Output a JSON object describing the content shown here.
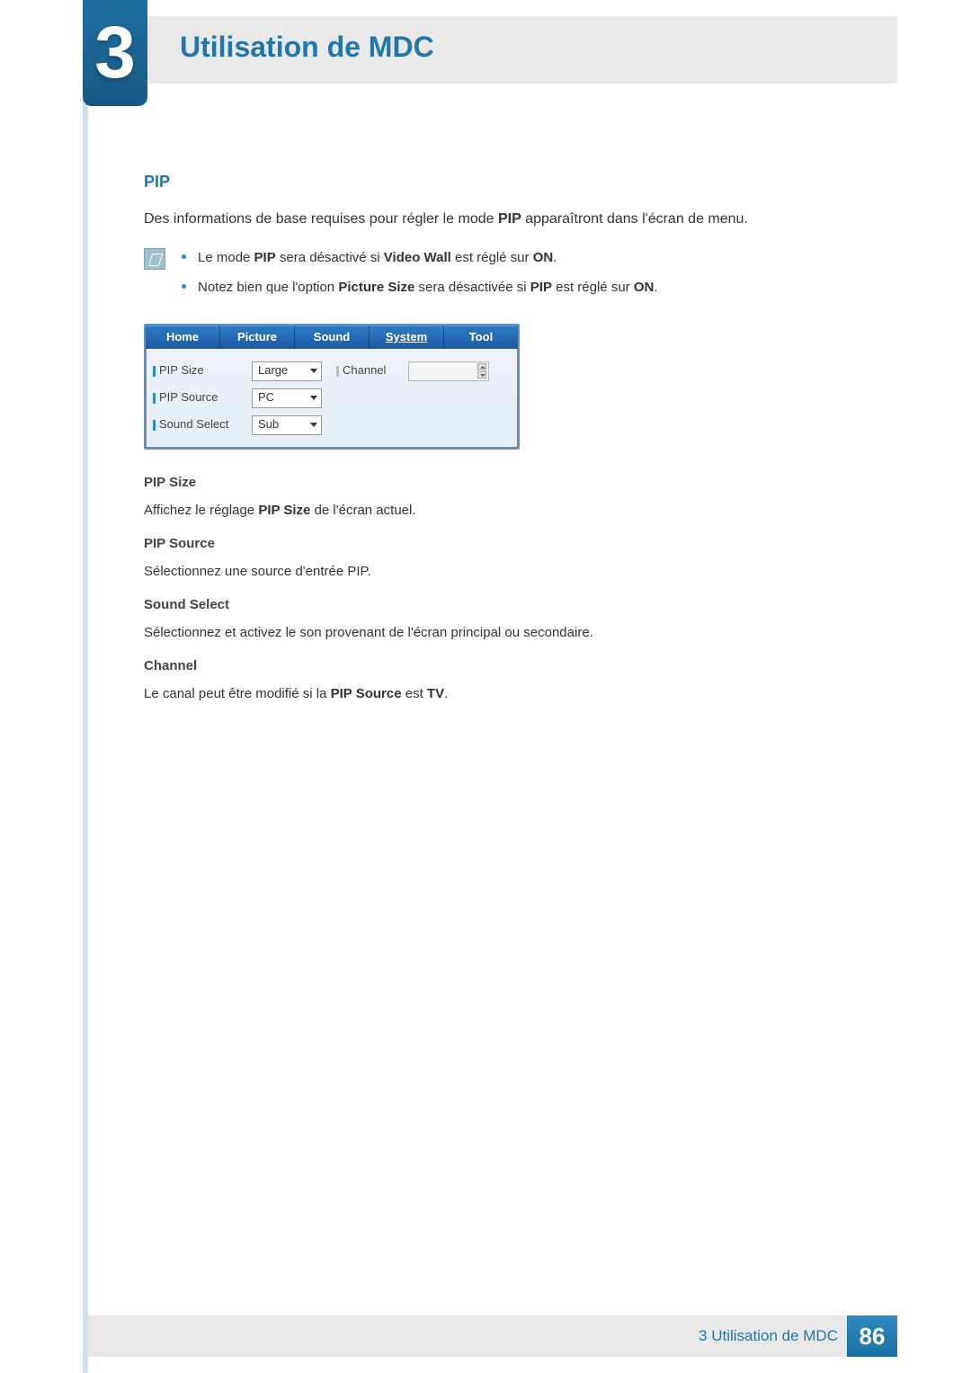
{
  "chapter": {
    "number": "3",
    "title": "Utilisation de MDC"
  },
  "section": {
    "heading": "PIP",
    "intro_pre": "Des informations de base requises pour régler le mode ",
    "intro_bold": "PIP",
    "intro_post": " apparaîtront dans l'écran de menu.",
    "notes": {
      "n1": {
        "pre": "Le mode ",
        "b1": "PIP",
        "mid": " sera désactivé si ",
        "b2": "Video Wall",
        "mid2": " est réglé sur ",
        "b3": "ON",
        "post": "."
      },
      "n2": {
        "pre": "Notez bien que l'option ",
        "b1": "Picture Size",
        "mid": " sera désactivée si ",
        "b2": "PIP",
        "mid2": " est réglé sur ",
        "b3": "ON",
        "post": "."
      }
    }
  },
  "panel": {
    "tabs": {
      "home": "Home",
      "picture": "Picture",
      "sound": "Sound",
      "system": "System",
      "tool": "Tool"
    },
    "rows": {
      "pip_size": {
        "label": "PIP Size",
        "value": "Large"
      },
      "pip_source": {
        "label": "PIP Source",
        "value": "PC"
      },
      "sound_select": {
        "label": "Sound Select",
        "value": "Sub"
      },
      "channel": {
        "label": "Channel",
        "value": ""
      }
    }
  },
  "descriptions": {
    "pip_size": {
      "title": "PIP Size",
      "pre": "Affichez le réglage ",
      "b": "PIP Size",
      "post": " de l'écran actuel."
    },
    "pip_source": {
      "title": "PIP Source",
      "text": "Sélectionnez une source d'entrée PIP."
    },
    "sound_select": {
      "title": "Sound Select",
      "text": "Sélectionnez et activez le son provenant de l'écran principal ou secondaire."
    },
    "channel": {
      "title": "Channel",
      "pre": "Le canal peut être modifié si la ",
      "b1": "PIP Source",
      "mid": " est ",
      "b2": "TV",
      "post": "."
    }
  },
  "footer": {
    "text": "3 Utilisation de MDC",
    "page": "86"
  }
}
